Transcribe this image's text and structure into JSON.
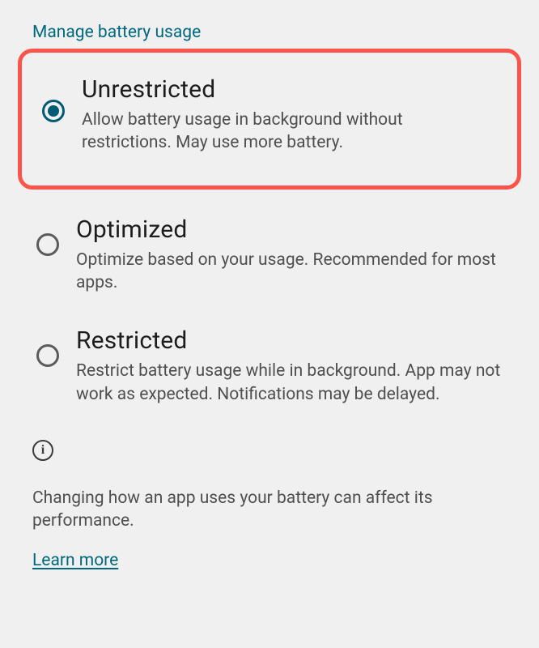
{
  "section_header": "Manage battery usage",
  "options": [
    {
      "title": "Unrestricted",
      "desc": "Allow battery usage in background without restrictions. May use more battery.",
      "selected": true,
      "highlighted": true
    },
    {
      "title": "Optimized",
      "desc": "Optimize based on your usage. Recommended for most apps.",
      "selected": false,
      "highlighted": false
    },
    {
      "title": "Restricted",
      "desc": "Restrict battery usage while in background. App may not work as expected. Notifications may be delayed.",
      "selected": false,
      "highlighted": false
    }
  ],
  "info": {
    "text": "Changing how an app uses your battery can affect its performance.",
    "learn_more": "Learn more"
  }
}
